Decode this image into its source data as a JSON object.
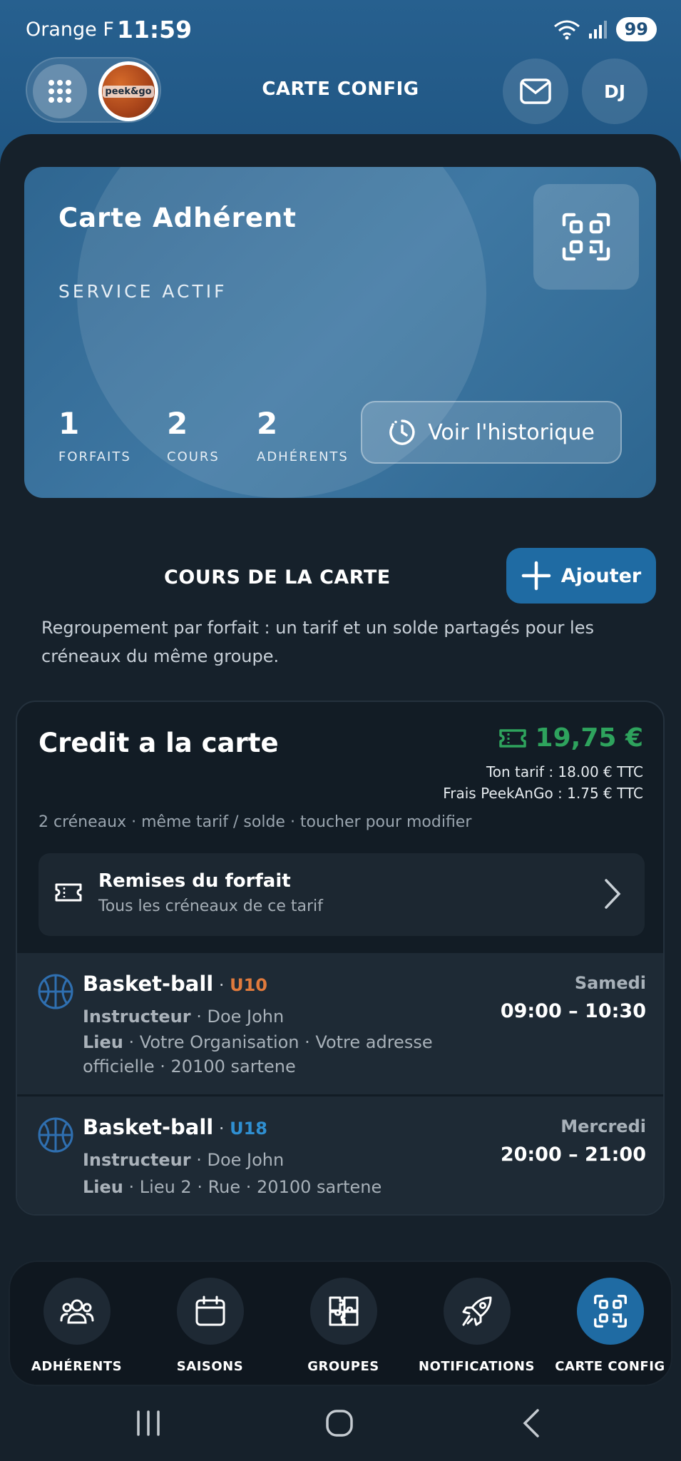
{
  "status": {
    "carrier": "Orange F",
    "time": "11:59",
    "battery": "99"
  },
  "header": {
    "title": "CARTE CONFIG",
    "avatar_initials": "DJ",
    "logo_text": "peek&go"
  },
  "card": {
    "title": "Carte Adhérent",
    "status": "SERVICE ACTIF",
    "stats": [
      {
        "value": "1",
        "label": "FORFAITS"
      },
      {
        "value": "2",
        "label": "COURS"
      },
      {
        "value": "2",
        "label": "ADHÉRENTS"
      }
    ],
    "history_button": "Voir l'historique"
  },
  "section": {
    "title": "COURS DE LA CARTE",
    "add_button": "Ajouter",
    "description": "Regroupement par forfait : un tarif et un solde partagés pour les créneaux du même groupe."
  },
  "forfait": {
    "name": "Credit a la carte",
    "price": "19,75 €",
    "tarif": "Ton tarif : 18.00 € TTC",
    "frais": "Frais PeekAnGo : 1.75 € TTC",
    "meta": "2 créneaux · même tarif / solde · toucher pour modifier",
    "remise_title": "Remises du forfait",
    "remise_sub": "Tous les créneaux de ce tarif",
    "accent_color": "#2ea35d"
  },
  "slots": [
    {
      "sport": "Basket-ball",
      "sep": " · ",
      "level": "U10",
      "instructor_label": "Instructeur",
      "instructor": " · Doe John",
      "place_label": "Lieu",
      "place": " · Votre Organisation · Votre adresse officielle · 20100 sartene",
      "day": "Samedi",
      "time": "09:00 – 10:30"
    },
    {
      "sport": "Basket-ball",
      "sep": " · ",
      "level": "U18",
      "instructor_label": "Instructeur",
      "instructor": " · Doe John",
      "place_label": "Lieu",
      "place": " · Lieu 2 · Rue · 20100 sartene",
      "day": "Mercredi",
      "time": "20:00 – 21:00"
    }
  ],
  "nav": [
    {
      "label": "ADHÉRENTS",
      "icon": "users-icon"
    },
    {
      "label": "SAISONS",
      "icon": "calendar-icon"
    },
    {
      "label": "GROUPES",
      "icon": "puzzle-icon"
    },
    {
      "label": "NOTIFICATIONS",
      "icon": "rocket-icon"
    },
    {
      "label": "CARTE CONFIG",
      "icon": "qr-icon",
      "active": true
    }
  ],
  "colors": {
    "primary": "#1f6ba3",
    "header": "#27608f",
    "background": "#16212b",
    "u10": "#e07a3c",
    "u18": "#2f8fd1"
  }
}
